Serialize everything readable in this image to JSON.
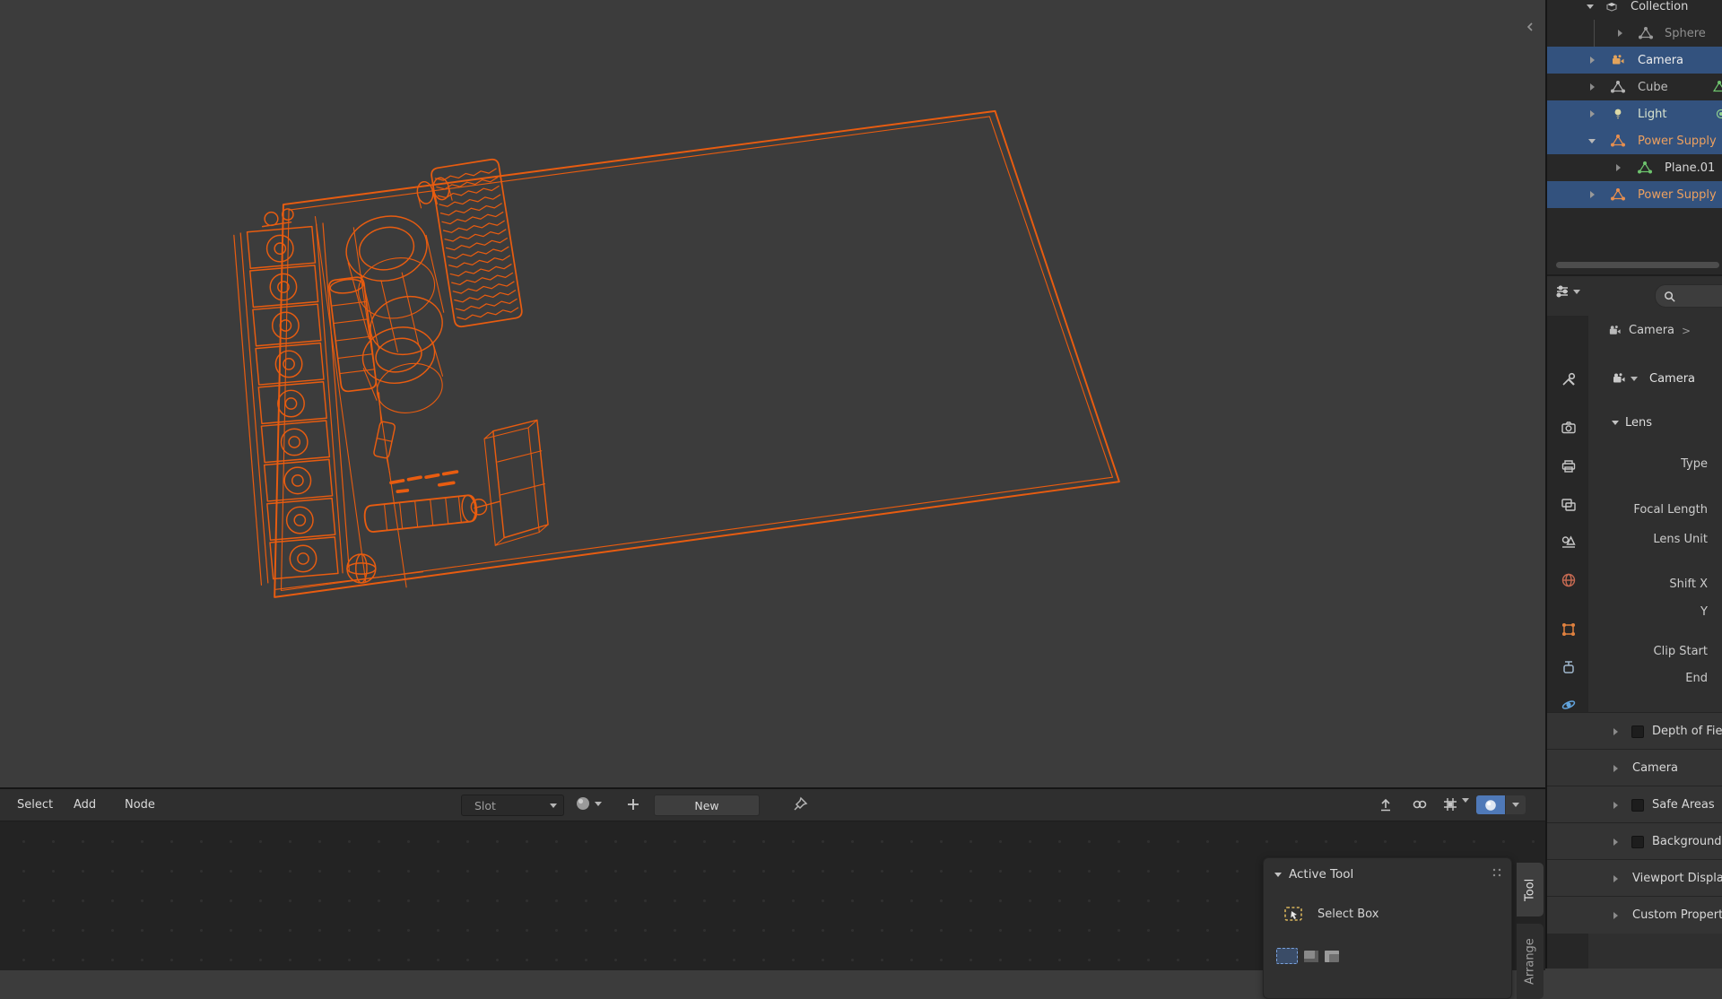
{
  "colors": {
    "wireframe_orange": "#e85c10",
    "selection_blue": "#33527e",
    "selected_text_orange": "#eda05f",
    "header_toggle_blue": "#4f79b8"
  },
  "outliner": {
    "items": [
      {
        "label": "Collection"
      },
      {
        "label": "Sphere"
      },
      {
        "label": "Camera"
      },
      {
        "label": "Cube"
      },
      {
        "label": "Light"
      },
      {
        "label": "Power Supply"
      },
      {
        "label": "Plane.01"
      },
      {
        "label": "Power Supply"
      }
    ]
  },
  "properties": {
    "breadcrumb": {
      "object": "Camera",
      "separator": ">"
    },
    "id_name": "Camera",
    "lens": {
      "title": "Lens",
      "fields": [
        "Type",
        "Focal Length",
        "Lens Unit",
        "Shift X",
        "Y",
        "Clip Start",
        "End"
      ]
    },
    "sections": [
      {
        "label": "Depth of Field"
      },
      {
        "label": "Camera"
      },
      {
        "label": "Safe Areas"
      },
      {
        "label": "Background Images"
      },
      {
        "label": "Viewport Display"
      },
      {
        "label": "Custom Properties"
      }
    ]
  },
  "shader_editor": {
    "menus": [
      "Select",
      "Add",
      "Node"
    ],
    "slot_label": "Slot",
    "new_button": "New",
    "active_tool_panel": {
      "title": "Active Tool",
      "tool": "Select Box"
    },
    "side_tabs": [
      "Tool",
      "Arrange"
    ]
  }
}
